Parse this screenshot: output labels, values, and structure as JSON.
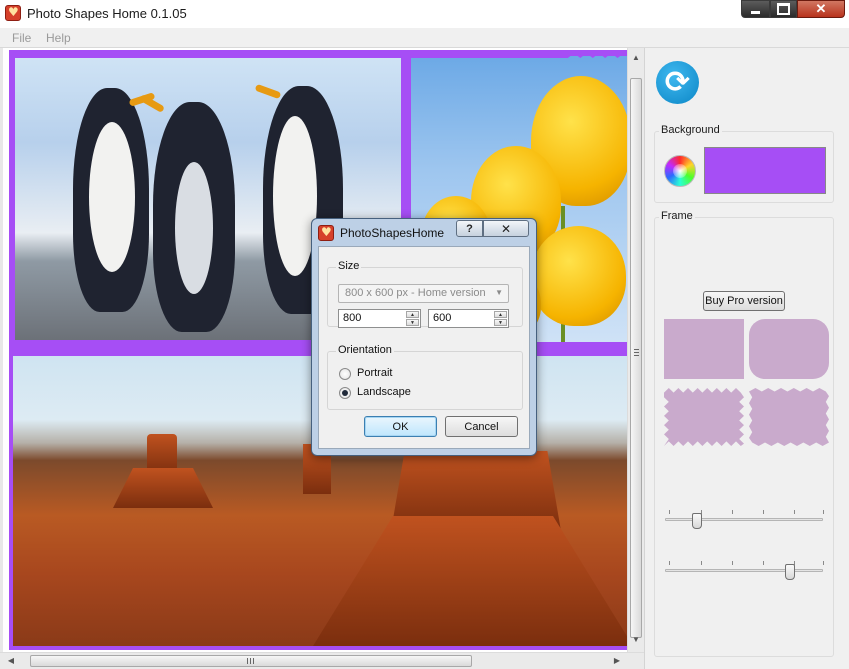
{
  "window": {
    "title": "Photo Shapes Home 0.1.05",
    "icon": "app-heart-icon"
  },
  "menu": {
    "items": [
      "File",
      "Help"
    ]
  },
  "canvas": {
    "background_color": "#a64ef5",
    "photos": [
      "penguins",
      "tulips",
      "desert-buttes"
    ]
  },
  "panel": {
    "refresh_icon": "refresh-icon",
    "background": {
      "label": "Background",
      "swatch_color": "#a64ef5"
    },
    "frame": {
      "label": "Frame",
      "buy_label": "Buy Pro version",
      "shape_color": "#c9aacc",
      "shapes": [
        "rectangle",
        "rounded-rectangle",
        "zigzag-rectangle",
        "wavy-rectangle"
      ]
    },
    "sliders": [
      {
        "name": "slider-1",
        "value": 0.2
      },
      {
        "name": "slider-2",
        "value": 0.8
      }
    ]
  },
  "dialog": {
    "title": "PhotoShapesHome",
    "help_label": "?",
    "close_label": "X",
    "size": {
      "label": "Size",
      "combo_value": "800 x  600 px - Home version",
      "width_value": "800",
      "height_value": "600"
    },
    "orientation": {
      "label": "Orientation",
      "portrait_label": "Portrait",
      "landscape_label": "Landscape",
      "selected": "Landscape"
    },
    "ok_label": "OK",
    "cancel_label": "Cancel"
  }
}
